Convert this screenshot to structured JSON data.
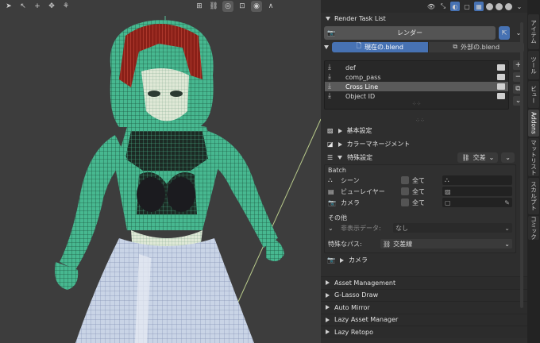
{
  "viewport": {
    "toolbar_left_icons": [
      "cursor-icon",
      "arrow-icon",
      "plus-icon",
      "hand-icon",
      "mesh-icon"
    ],
    "toolbar_right_icons": [
      "shading-icon",
      "link-icon",
      "snap-icon",
      "grid-icon",
      "falloff-icon"
    ]
  },
  "panel": {
    "header_icons": [
      "view-icon",
      "visibility-icon",
      "render-icon",
      "material-icon",
      "shading-solid-icon",
      "shading-material-icon",
      "shading-rendered-icon"
    ],
    "section_title": "Render Task List",
    "render_label": "レンダー",
    "toggle": {
      "current": "現在の.blend",
      "external": "外部の.blend"
    },
    "tasks": [
      {
        "name": "def",
        "selected": false
      },
      {
        "name": "comp_pass",
        "selected": false
      },
      {
        "name": "Cross Line",
        "selected": true
      },
      {
        "name": "Object ID",
        "selected": false
      }
    ],
    "basic_settings": "基本設定",
    "color_management": "カラーマネージメント",
    "special_settings": "特殊設定",
    "special_dropdown": "交差",
    "batch": {
      "title": "Batch",
      "rows": [
        {
          "name": "シーン",
          "all": "全て"
        },
        {
          "name": "ビューレイヤー",
          "all": "全て"
        },
        {
          "name": "カメラ",
          "all": "全て"
        }
      ]
    },
    "other": {
      "title": "その他",
      "hidden_label": "非表示データ:",
      "hidden_value": "なし",
      "special_pass_label": "特殊なパス:",
      "special_pass_value": "交差線"
    },
    "camera_section": "カメラ",
    "addons": [
      "Asset Management",
      "G-Lasso Draw",
      "Auto Mirror",
      "Lazy Asset Manager",
      "Lazy Retopo"
    ]
  },
  "tabs": [
    {
      "label": "アイテム",
      "active": false
    },
    {
      "label": "ツール",
      "active": false
    },
    {
      "label": "ビュー",
      "active": false
    },
    {
      "label": "Addons",
      "active": true
    },
    {
      "label": "マットリスト",
      "active": false
    },
    {
      "label": "スカルプト",
      "active": false
    },
    {
      "label": "コミック",
      "active": false
    }
  ],
  "colors": {
    "accent": "#4772b3",
    "wire": "#5de0b0",
    "hair": "#c0392b",
    "viewport_bg": "#3d3d3d"
  }
}
